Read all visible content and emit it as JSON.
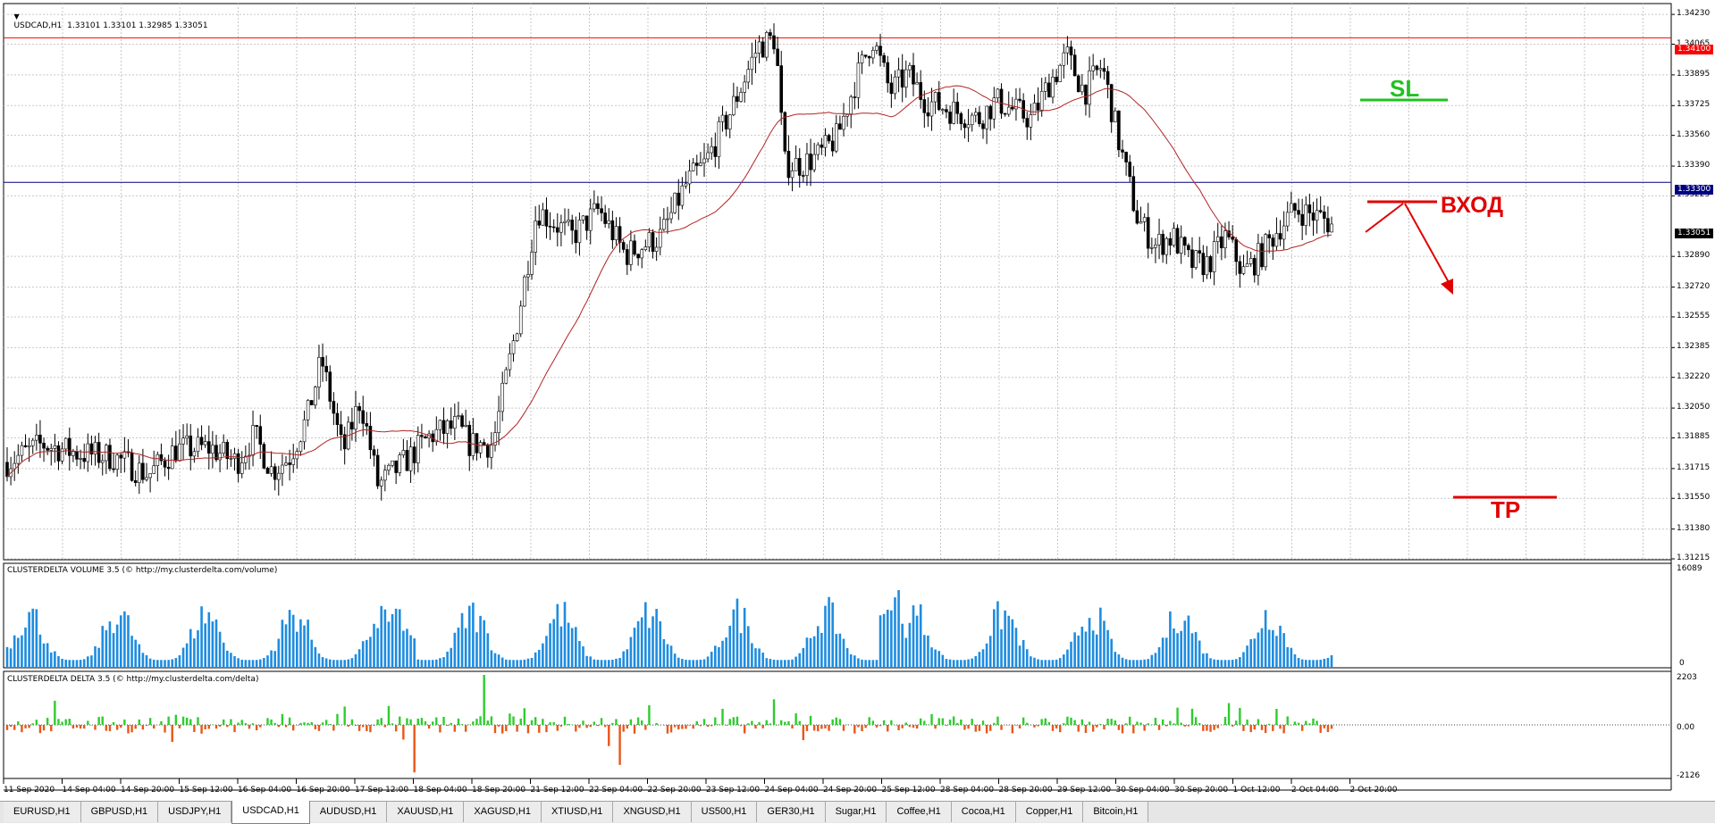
{
  "chart": {
    "symbol": "USDCAD,H1",
    "ohlc": "1.33101 1.33101 1.32985 1.33051",
    "title_line": "USDCAD,H1  1.33101 1.33101 1.32985 1.33051",
    "price_axis": [
      "1.34230",
      "1.34065",
      "1.33895",
      "1.33725",
      "1.33560",
      "1.33390",
      "1.33225",
      "1.32890",
      "1.32720",
      "1.32555",
      "1.32385",
      "1.32220",
      "1.32050",
      "1.31885",
      "1.31715",
      "1.31550",
      "1.31380",
      "1.31215"
    ],
    "price_range": [
      1.3121,
      1.3429
    ],
    "levels": {
      "red_line": {
        "price": 1.341,
        "label": "1.34100",
        "color": "#ff0000"
      },
      "blue_line": {
        "price": 1.333,
        "label": "1.33300",
        "color": "#000080"
      },
      "current": {
        "price": 1.33051,
        "label": "1.33051",
        "color": "#000000"
      }
    },
    "moving_average_color": "#b22222"
  },
  "annotations": {
    "sl": {
      "label": "SL",
      "color": "#22c022"
    },
    "entry": {
      "label": "ВХОД",
      "color": "#e00000"
    },
    "tp": {
      "label": "TP",
      "color": "#e00000"
    }
  },
  "volume_pane": {
    "title": "CLUSTERDELTA VOLUME 3.5 (© http://my.clusterdelta.com/volume)",
    "max_label": "16089",
    "min_label": "0",
    "bar_color": "#1e8ce0"
  },
  "delta_pane": {
    "title": "CLUSTERDELTA DELTA 3.5 (© http://my.clusterdelta.com/delta)",
    "max_label": "2203",
    "zero_label": "0.00",
    "min_label": "-2126",
    "positive_color": "#2ecc2e",
    "negative_color": "#e8561a"
  },
  "time_axis": [
    "11 Sep 2020",
    "14 Sep 04:00",
    "14 Sep 20:00",
    "15 Sep 12:00",
    "16 Sep 04:00",
    "16 Sep 20:00",
    "17 Sep 12:00",
    "18 Sep 04:00",
    "18 Sep 20:00",
    "21 Sep 12:00",
    "22 Sep 04:00",
    "22 Sep 20:00",
    "23 Sep 12:00",
    "24 Sep 04:00",
    "24 Sep 20:00",
    "25 Sep 12:00",
    "28 Sep 04:00",
    "28 Sep 20:00",
    "29 Sep 12:00",
    "30 Sep 04:00",
    "30 Sep 20:00",
    "1 Oct 12:00",
    "2 Oct 04:00",
    "2 Oct 20:00"
  ],
  "tabs": [
    "EURUSD,H1",
    "GBPUSD,H1",
    "USDJPY,H1",
    "USDCAD,H1",
    "AUDUSD,H1",
    "XAUUSD,H1",
    "XAGUSD,H1",
    "XTIUSD,H1",
    "XNGUSD,H1",
    "US500,H1",
    "GER30,H1",
    "Sugar,H1",
    "Coffee,H1",
    "Cocoa,H1",
    "Copper,H1",
    "Bitcoin,H1"
  ],
  "active_tab": "USDCAD,H1"
}
